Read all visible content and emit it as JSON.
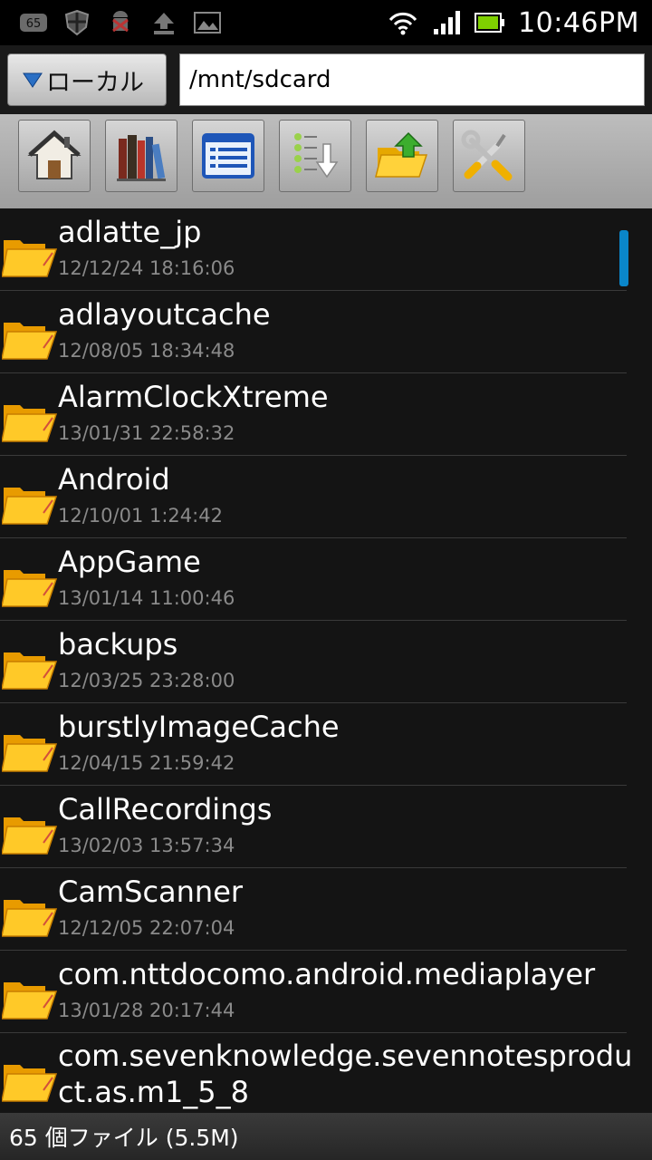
{
  "status_bar": {
    "notification_badge": "65",
    "time": "10:46PM",
    "icons": [
      "badge-icon",
      "shield-icon",
      "android-debug-icon",
      "upload-icon",
      "image-icon",
      "wifi-icon",
      "signal-icon",
      "battery-icon"
    ]
  },
  "address": {
    "location_button": "ローカル",
    "path": "/mnt/sdcard"
  },
  "toolbar": {
    "buttons": [
      "home-icon",
      "bookmarks-icon",
      "list-view-icon",
      "sort-icon",
      "folder-up-icon",
      "tools-icon"
    ]
  },
  "files": [
    {
      "name": "adlatte_jp",
      "date": "12/12/24 18:16:06"
    },
    {
      "name": "adlayoutcache",
      "date": "12/08/05 18:34:48"
    },
    {
      "name": "AlarmClockXtreme",
      "date": "13/01/31 22:58:32"
    },
    {
      "name": "Android",
      "date": "12/10/01 1:24:42"
    },
    {
      "name": "AppGame",
      "date": "13/01/14 11:00:46"
    },
    {
      "name": "backups",
      "date": "12/03/25 23:28:00"
    },
    {
      "name": "burstlyImageCache",
      "date": "12/04/15 21:59:42"
    },
    {
      "name": "CallRecordings",
      "date": "13/02/03 13:57:34"
    },
    {
      "name": "CamScanner",
      "date": "12/12/05 22:07:04"
    },
    {
      "name": "com.nttdocomo.android.mediaplayer",
      "date": "13/01/28 20:17:44"
    },
    {
      "name": "com.sevenknowledge.sevennotesproduct.as.m1_5_8",
      "date": ""
    }
  ],
  "footer": {
    "summary": "65 個ファイル (5.5M)"
  },
  "colors": {
    "scroll_indicator": "#0a86c9",
    "folder": "#f5b800"
  }
}
